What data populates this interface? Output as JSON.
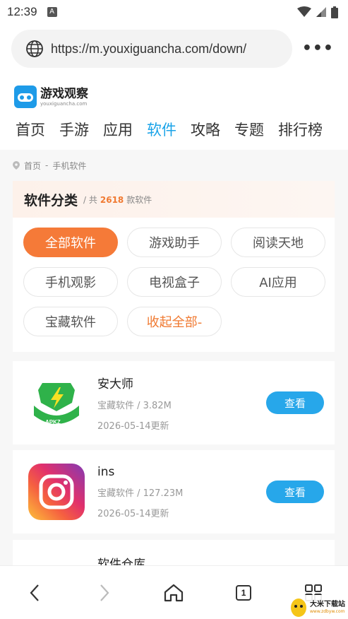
{
  "status": {
    "time": "12:39",
    "a_badge": "A"
  },
  "browser": {
    "url": "https://m.youxiguancha.com/down/"
  },
  "site": {
    "logo_cn": "游戏观察",
    "logo_en": "youxiguancha.com"
  },
  "nav": [
    "首页",
    "手游",
    "应用",
    "软件",
    "攻略",
    "专题",
    "排行榜"
  ],
  "nav_active_index": 3,
  "breadcrumb": {
    "home": "首页",
    "sep": "-",
    "current": "手机软件"
  },
  "category": {
    "title": "软件分类",
    "sub_prefix": "/ 共",
    "count": "2618",
    "sub_suffix": "款软件",
    "tags": [
      "全部软件",
      "游戏助手",
      "阅读天地",
      "手机观影",
      "电视盒子",
      "AI应用",
      "宝藏软件",
      "收起全部-"
    ]
  },
  "apps": [
    {
      "name": "安大师",
      "meta": "宝藏软件 / 3.82M",
      "date": "2026-05-14更新",
      "button": "查看",
      "icon": "apkz-shield-icon"
    },
    {
      "name": "ins",
      "meta": "宝藏软件 / 127.23M",
      "date": "2026-05-14更新",
      "button": "查看",
      "icon": "instagram-camera-icon"
    },
    {
      "name": "软件仓库"
    }
  ],
  "bottom_bar": {
    "tab_count": "1"
  },
  "watermark": {
    "text": "大米下载站",
    "url": "www.zdbyw.com"
  },
  "colors": {
    "accent_blue": "#1aa3e8",
    "accent_orange": "#f57a38",
    "button_blue": "#27a7ea"
  }
}
